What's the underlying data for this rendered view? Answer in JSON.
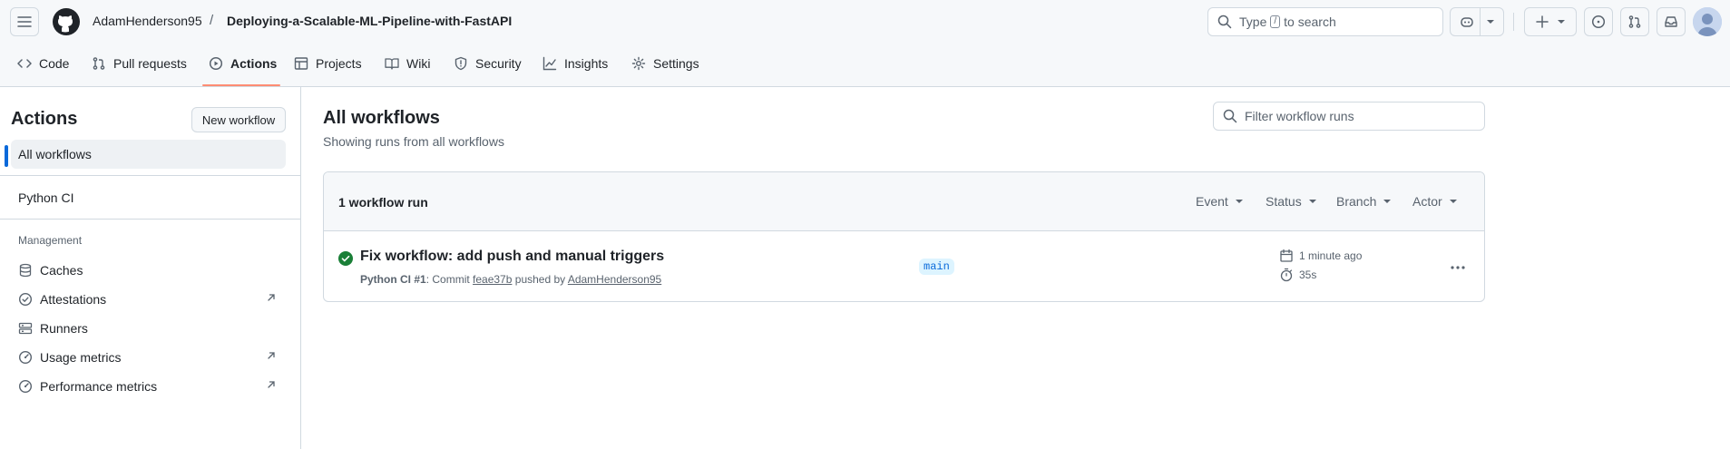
{
  "header": {
    "owner": "AdamHenderson95",
    "separator": "/",
    "repo": "Deploying-a-Scalable-ML-Pipeline-with-FastAPI",
    "search": {
      "prefix": "Type",
      "key": "/",
      "suffix": "to search"
    }
  },
  "repo_nav": {
    "tabs": [
      {
        "label": "Code",
        "icon": "code-icon"
      },
      {
        "label": "Pull requests",
        "icon": "git-pull-request-icon"
      },
      {
        "label": "Actions",
        "icon": "play-icon",
        "active": true
      },
      {
        "label": "Projects",
        "icon": "table-icon"
      },
      {
        "label": "Wiki",
        "icon": "book-icon"
      },
      {
        "label": "Security",
        "icon": "shield-icon"
      },
      {
        "label": "Insights",
        "icon": "graph-icon"
      },
      {
        "label": "Settings",
        "icon": "gear-icon"
      }
    ]
  },
  "sidebar": {
    "title": "Actions",
    "new_workflow": "New workflow",
    "all_workflows": "All workflows",
    "workflows": [
      "Python CI"
    ],
    "management_heading": "Management",
    "management": [
      {
        "label": "Caches",
        "icon": "database-icon",
        "external": false
      },
      {
        "label": "Attestations",
        "icon": "verified-icon",
        "external": true
      },
      {
        "label": "Runners",
        "icon": "server-icon",
        "external": false
      },
      {
        "label": "Usage metrics",
        "icon": "meter-icon",
        "external": true
      },
      {
        "label": "Performance metrics",
        "icon": "meter-icon",
        "external": true
      }
    ]
  },
  "main": {
    "title": "All workflows",
    "subtitle": "Showing runs from all workflows",
    "filter_placeholder": "Filter workflow runs",
    "run_count": "1 workflow run",
    "filters": [
      "Event",
      "Status",
      "Branch",
      "Actor"
    ],
    "runs": [
      {
        "title": "Fix workflow: add push and manual triggers",
        "workflow": "Python CI #1",
        "commit_prefix": ": Commit",
        "commit": "feae37b",
        "pushed_by": "pushed by",
        "actor": "AdamHenderson95",
        "branch": "main",
        "time": "1 minute ago",
        "duration": "35s",
        "status": "success"
      }
    ]
  },
  "colors": {
    "accent": "#0969da",
    "success": "#1a7f37",
    "nav_underline": "#fd8c73"
  }
}
